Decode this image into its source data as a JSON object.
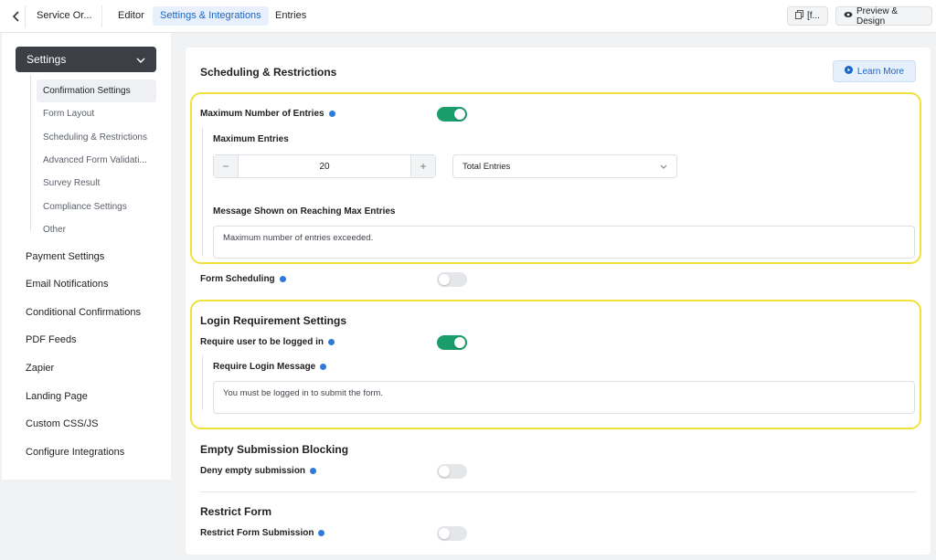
{
  "topbar": {
    "form_name": "Service Or...",
    "tabs": [
      "Editor",
      "Settings & Integrations",
      "Entries"
    ],
    "shortcode_label": "[f...",
    "preview_label": "Preview & Design"
  },
  "sidebar": {
    "settings_label": "Settings",
    "sub_items": [
      "Confirmation Settings",
      "Form Layout",
      "Scheduling & Restrictions",
      "Advanced Form Validati...",
      "Survey Result",
      "Compliance Settings",
      "Other"
    ],
    "main_items": [
      "Payment Settings",
      "Email Notifications",
      "Conditional Confirmations",
      "PDF Feeds",
      "Zapier",
      "Landing Page",
      "Custom CSS/JS",
      "Configure Integrations"
    ]
  },
  "main": {
    "title": "Scheduling & Restrictions",
    "learn_more": "Learn More",
    "max_entries": {
      "label": "Maximum Number of Entries",
      "enabled": true,
      "sub_label": "Maximum Entries",
      "value": "20",
      "minus": "−",
      "plus": "+",
      "period": "Total Entries",
      "message_label": "Message Shown on Reaching Max Entries",
      "message": "Maximum number of entries exceeded."
    },
    "form_scheduling": {
      "label": "Form Scheduling",
      "enabled": false
    },
    "login": {
      "title": "Login Requirement Settings",
      "label": "Require user to be logged in",
      "enabled": true,
      "message_label": "Require Login Message",
      "message": "You must be logged in to submit the form."
    },
    "empty": {
      "title": "Empty Submission Blocking",
      "label": "Deny empty submission",
      "enabled": false
    },
    "restrict": {
      "title": "Restrict Form",
      "label": "Restrict Form Submission",
      "enabled": false
    }
  },
  "colors": {
    "accent": "#1a66c7",
    "toggle_on": "#1a9c6b",
    "highlight": "#f1e23b"
  }
}
